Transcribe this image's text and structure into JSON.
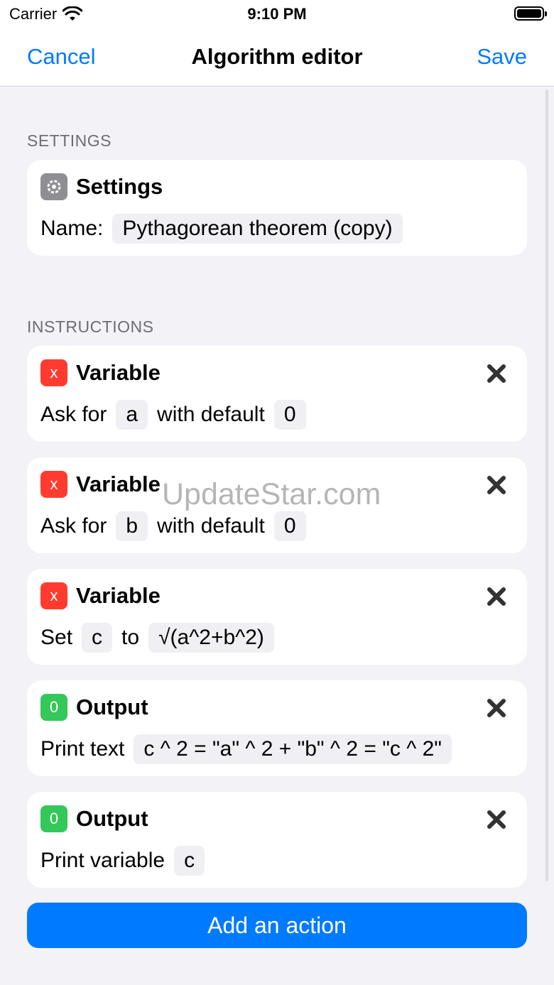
{
  "status_bar": {
    "carrier": "Carrier",
    "time": "9:10 PM"
  },
  "nav": {
    "cancel_label": "Cancel",
    "title": "Algorithm editor",
    "save_label": "Save"
  },
  "settings_section": {
    "header": "SETTINGS",
    "card_title": "Settings",
    "name_label": "Name:",
    "name_value": "Pythagorean theorem (copy)"
  },
  "instructions_section": {
    "header": "INSTRUCTIONS",
    "items": [
      {
        "badge": "x",
        "title": "Variable",
        "t1": "Ask for",
        "v1": "a",
        "t2": "with default",
        "v2": "0"
      },
      {
        "badge": "x",
        "title": "Variable",
        "t1": "Ask for",
        "v1": "b",
        "t2": "with default",
        "v2": "0"
      },
      {
        "badge": "x",
        "title": "Variable",
        "t1": "Set",
        "v1": "c",
        "t2": "to",
        "v2": "√(a^2+b^2)"
      },
      {
        "badge": "0",
        "title": "Output",
        "t1": "Print text",
        "v1": "c ^ 2 = \"a\" ^ 2 + \"b\" ^ 2 = \"c ^ 2\""
      },
      {
        "badge": "0",
        "title": "Output",
        "t1": "Print variable",
        "v1": "c"
      }
    ]
  },
  "add_action_label": "Add an action",
  "watermark": "UpdateStar.com",
  "colors": {
    "accent": "#007aff",
    "variable_badge": "#ff3b30",
    "output_badge": "#34c759",
    "settings_badge": "#8e8e93"
  }
}
